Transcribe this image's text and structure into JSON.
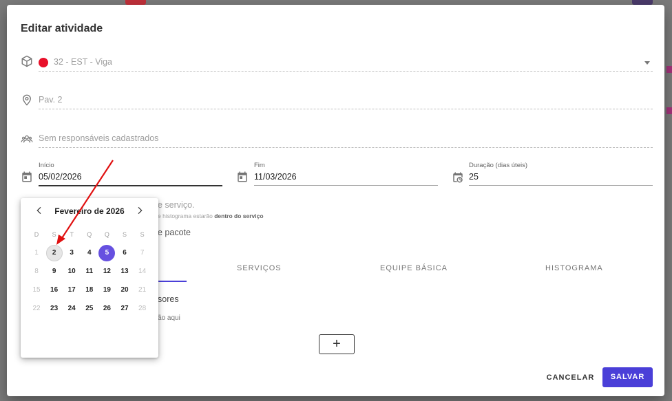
{
  "dialog": {
    "title": "Editar atividade",
    "activity": {
      "value": "32 - EST - Viga",
      "dot_color": "#e8102a"
    },
    "location": {
      "value": "Pav. 2"
    },
    "responsibles": {
      "value": "Sem responsáveis cadastrados"
    },
    "start": {
      "label": "Início",
      "value": "05/02/2026"
    },
    "end": {
      "label": "Fim",
      "value": "11/03/2026"
    },
    "duration": {
      "label": "Duração (dias úteis)",
      "value": "25"
    },
    "hint_service": "e serviço.",
    "hint_histogram_pre": "e histograma estarão ",
    "hint_histogram_bold": "dentro do serviço",
    "hint_pacote": "e pacote",
    "tabs": [
      "SERVIÇOS",
      "EQUIPE BÁSICA",
      "HISTOGRAMA"
    ],
    "fragment_sores": "sores",
    "fragment_aqui": "ão aqui",
    "add_label": "+",
    "cancel_label": "CANCELAR",
    "save_label": "SALVAR",
    "accent_color": "#4a3fd8"
  },
  "datepicker": {
    "month_label": "Fevereiro de 2026",
    "weekdays": [
      "D",
      "S",
      "T",
      "Q",
      "Q",
      "S",
      "S"
    ],
    "weeks": [
      [
        "1",
        "2",
        "3",
        "4",
        "5",
        "6",
        "7"
      ],
      [
        "8",
        "9",
        "10",
        "11",
        "12",
        "13",
        "14"
      ],
      [
        "15",
        "16",
        "17",
        "18",
        "19",
        "20",
        "21"
      ],
      [
        "22",
        "23",
        "24",
        "25",
        "26",
        "27",
        "28"
      ]
    ],
    "selected": "5",
    "hovered": "2",
    "selected_color": "#6650e0"
  },
  "annotation": {
    "arrow_color": "#e01010"
  }
}
